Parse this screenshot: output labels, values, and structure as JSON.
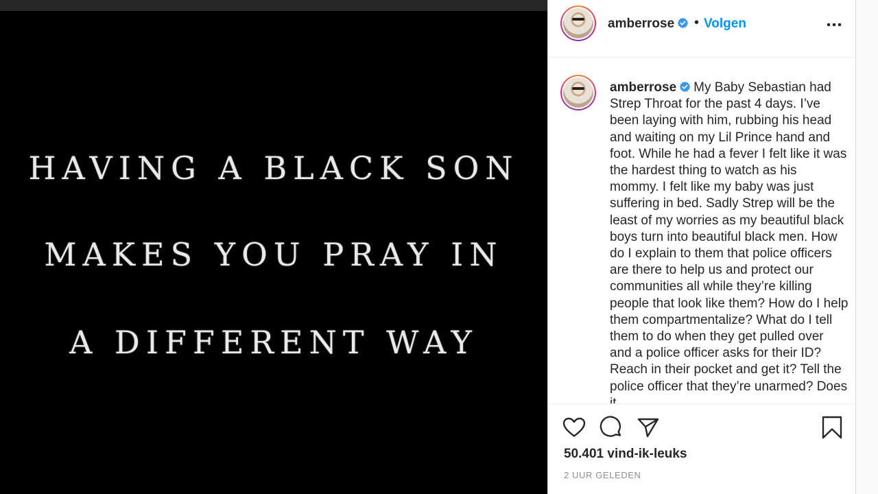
{
  "post_image": {
    "lines": [
      "HAVING A BLACK SON",
      "MAKES YOU PRAY IN",
      "A DIFFERENT WAY"
    ]
  },
  "header": {
    "username": "amberrose",
    "separator": "•",
    "follow_label": "Volgen",
    "more_icon": "more-horizontal-icon",
    "verified_icon": "verified-badge-icon"
  },
  "caption": {
    "username": "amberrose",
    "text": "My Baby Sebastian had Strep Throat for the past 4 days. I’ve been laying with him, rubbing his head and waiting on my Lil Prince hand and foot. While he had a fever I felt like it was the hardest thing to watch as his mommy. I felt like my baby was just suffering in bed. Sadly Strep will be the least of my worries as my beautiful black boys turn into beautiful black men. How do I explain to them that police officers are there to help us and protect our communities all while they’re killing people that look like them? How do I help them compartmentalize? What do I tell them to do when they get pulled over and a police officer asks for their ID? Reach in their pocket and get it? Tell the police officer that they’re unarmed? Does it"
  },
  "actions": {
    "like_icon": "heart-icon",
    "comment_icon": "comment-icon",
    "share_icon": "paper-plane-icon",
    "save_icon": "bookmark-icon",
    "likes_text": "50.401 vind-ik-leuks",
    "timestamp": "2 UUR GELEDEN"
  },
  "colors": {
    "link_blue": "#0095f6",
    "verified_blue": "#3897f0",
    "text": "#262626",
    "muted": "#8e8e8e"
  }
}
